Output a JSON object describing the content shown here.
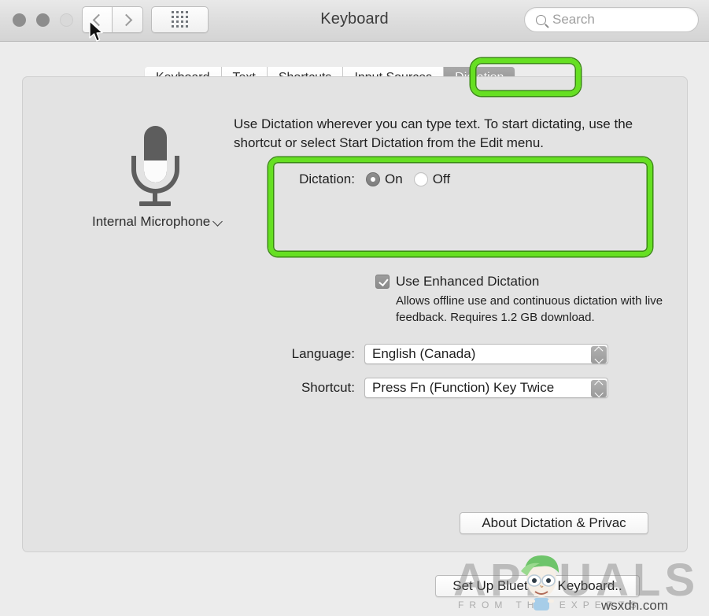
{
  "window": {
    "title": "Keyboard",
    "traffic_lights": [
      "close",
      "minimize",
      "zoom"
    ],
    "back_label": "back",
    "forward_label": "forward",
    "grid_label": "show-all"
  },
  "search": {
    "placeholder": "Search",
    "icon": "search-icon"
  },
  "tabs": [
    {
      "label": "Keyboard",
      "selected": false
    },
    {
      "label": "Text",
      "selected": false
    },
    {
      "label": "Shortcuts",
      "selected": false
    },
    {
      "label": "Input Sources",
      "selected": false
    },
    {
      "label": "Dictation",
      "selected": true
    }
  ],
  "microphone": {
    "icon": "microphone-icon",
    "label": "Internal Microphone"
  },
  "description": "Use Dictation wherever you can type text. To start dictating, use the shortcut or select Start Dictation from the Edit menu.",
  "dictation": {
    "label": "Dictation:",
    "on_label": "On",
    "off_label": "Off",
    "selected": "On",
    "enhanced": {
      "label": "Use Enhanced Dictation",
      "checked": true,
      "description": "Allows offline use and continuous dictation with live feedback. Requires 1.2 GB download."
    }
  },
  "language": {
    "label": "Language:",
    "value": "English (Canada)"
  },
  "shortcut": {
    "label": "Shortcut:",
    "value": "Press Fn (Function) Key Twice"
  },
  "buttons": {
    "about": "About Dictation & Privac",
    "bluetooth": "Set Up Bluetooth Keyboard.."
  },
  "annotations": {
    "color": "#66e022",
    "targets": [
      "dictation-tab",
      "dictation-settings-group"
    ]
  },
  "watermark": {
    "wordmark": "APPUALS",
    "tagline": "FROM THE EXPERTS",
    "site": "wsxdn.com"
  }
}
